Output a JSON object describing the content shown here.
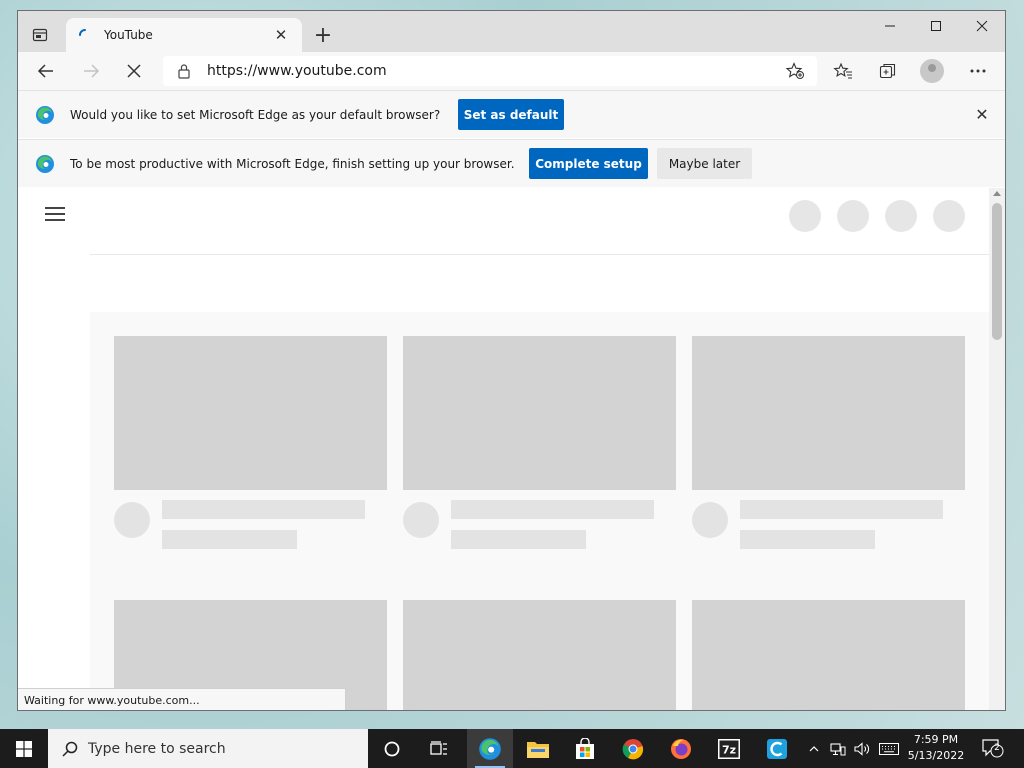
{
  "browser": {
    "tab": {
      "title": "YouTube"
    },
    "address": {
      "url": "https://www.youtube.com"
    }
  },
  "infobars": {
    "default_browser": {
      "message": "Would you like to set Microsoft Edge as your default browser?",
      "button": "Set as default"
    },
    "setup": {
      "message": "To be most productive with Microsoft Edge, finish setting up your browser.",
      "primary_button": "Complete setup",
      "secondary_button": "Maybe later"
    }
  },
  "status_bar": {
    "text": "Waiting for www.youtube.com..."
  },
  "taskbar": {
    "search_placeholder": "Type here to search",
    "apps": [
      "task-view",
      "edge",
      "file-explorer",
      "microsoft-store",
      "chrome",
      "firefox",
      "7zip",
      "ccleaner"
    ],
    "clock": {
      "time": "7:59 PM",
      "date": "5/13/2022"
    },
    "notification_count": "2"
  },
  "colors": {
    "accent": "#0067c0",
    "placeholder": "#d3d3d3",
    "taskbar": "#1c1c1c"
  }
}
